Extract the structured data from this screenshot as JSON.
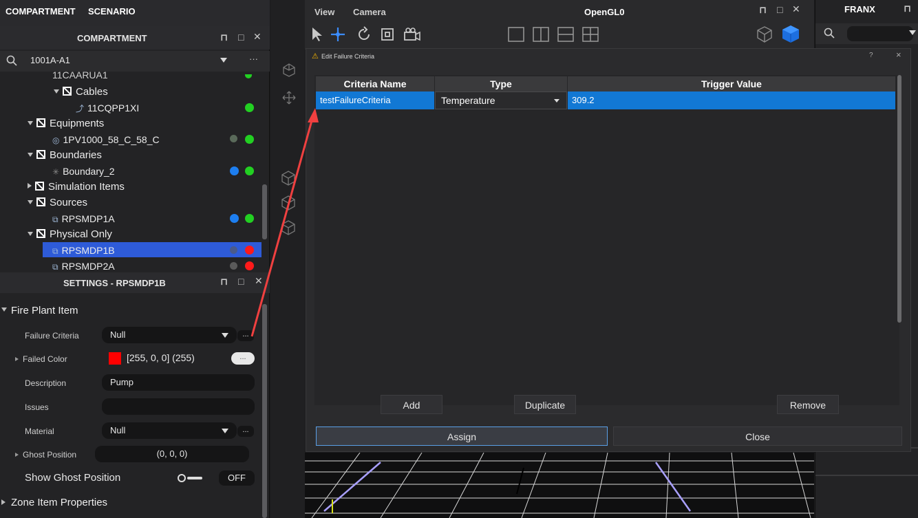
{
  "left_panel": {
    "tabs": [
      "COMPARTMENT",
      "SCENARIO"
    ],
    "compartment_title": "COMPARTMENT",
    "search_value": "1001A-A1",
    "more": "···",
    "tree": [
      {
        "label": "11CAARUA1"
      },
      {
        "label": "Cables"
      },
      {
        "label": "11CQPP1XI"
      },
      {
        "label": "Equipments"
      },
      {
        "label": "1PV1000_58_C_58_C"
      },
      {
        "label": "Boundaries"
      },
      {
        "label": "Boundary_2"
      },
      {
        "label": "Simulation Items"
      },
      {
        "label": "Sources"
      },
      {
        "label": "RPSMDP1A"
      },
      {
        "label": "Physical Only"
      },
      {
        "label": "RPSMDP1B"
      },
      {
        "label": "RPSMDP2A"
      }
    ],
    "settings_title": "SETTINGS - RPSMDP1B",
    "settings": {
      "section": "Fire Plant Item",
      "failure_criteria_label": "Failure Criteria",
      "failure_criteria_value": "Null",
      "failed_color_label": "Failed Color",
      "failed_color_value": "[255, 0, 0] (255)",
      "description_label": "Description",
      "description_value": "Pump",
      "issues_label": "Issues",
      "material_label": "Material",
      "material_value": "Null",
      "ghost_position_label": "Ghost Position",
      "ghost_position_value": "(0, 0, 0)",
      "show_ghost_label": "Show Ghost Position",
      "show_ghost_value": "OFF",
      "zone_section": "Zone Item Properties",
      "ellipsis": "..."
    }
  },
  "viewbar": {
    "menu_view": "View",
    "menu_camera": "Camera",
    "title": "OpenGL0"
  },
  "right_panel": {
    "title": "FRANX"
  },
  "dialog": {
    "title": "Edit Failure Criteria",
    "help": "?",
    "close_x": "×",
    "columns": [
      "Criteria Name",
      "Type",
      "Trigger Value"
    ],
    "row": {
      "name": "testFailureCriteria",
      "type": "Temperature",
      "trigger": "309.2"
    },
    "buttons": {
      "add": "Add",
      "duplicate": "Duplicate",
      "remove": "Remove",
      "assign": "Assign",
      "close": "Close"
    }
  },
  "colors": {
    "selection": "#2e5bd8",
    "row_highlight": "#1278d4",
    "status_green": "#22d022",
    "status_red": "#ff1a1a",
    "failed_color": "#ff0000",
    "arrow": "#f04040"
  }
}
